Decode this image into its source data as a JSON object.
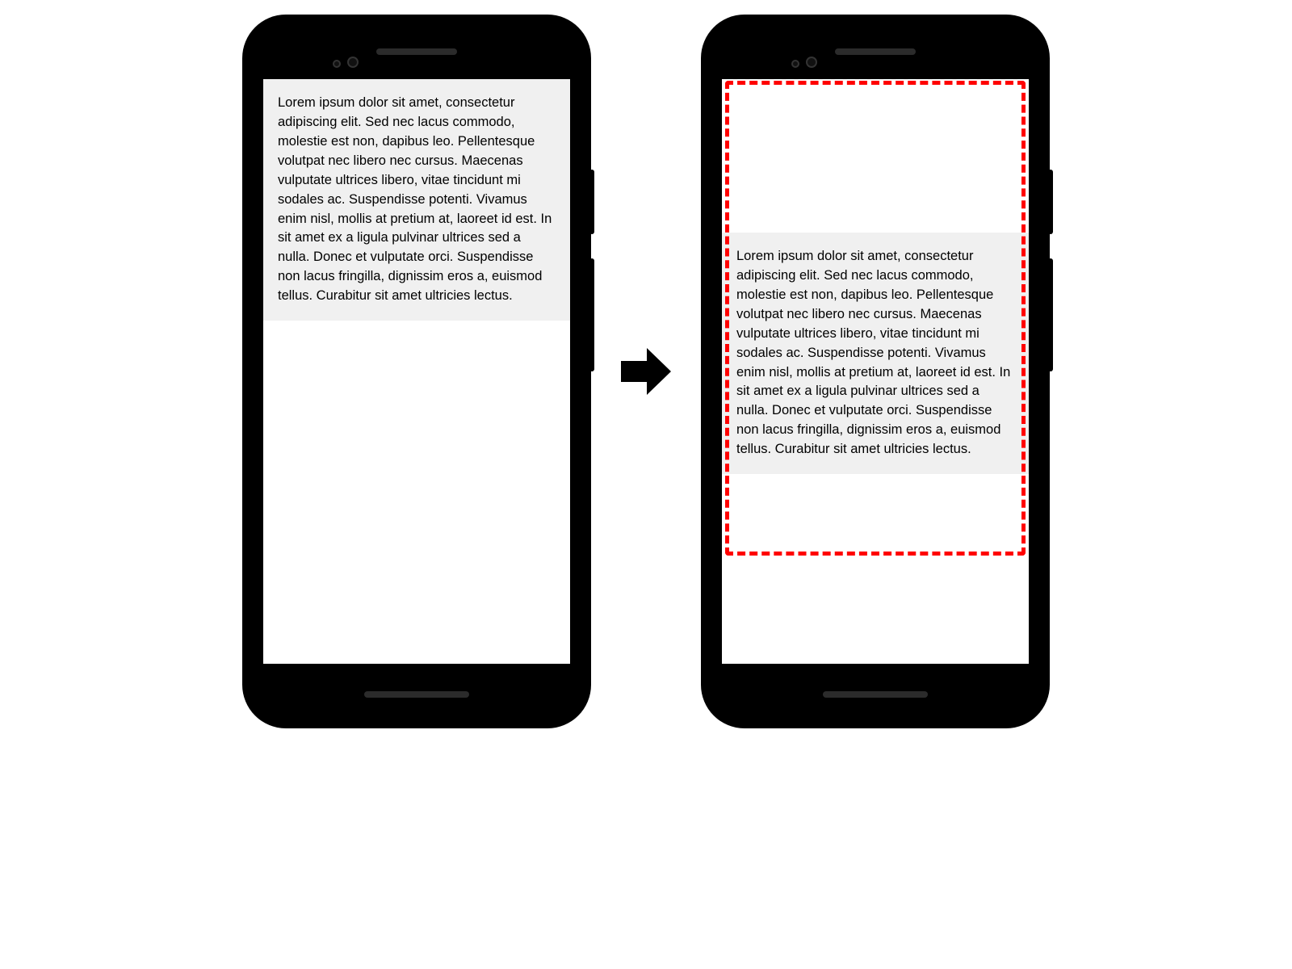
{
  "lorem_text": "Lorem ipsum dolor sit amet, consectetur adipiscing elit. Sed nec lacus commodo, molestie est non, dapibus leo. Pellentesque volutpat nec libero nec cursus. Maecenas vulputate ultrices libero, vitae tincidunt mi sodales ac. Suspendisse potenti. Vivamus enim nisl, mollis at pretium at, laoreet id est. In sit amet ex a ligula pulvinar ultrices sed a nulla. Donec et vulputate orci. Suspendisse non lacus fringilla, dignissim eros a, euismod tellus. Curabitur sit amet ultricies lectus.",
  "colors": {
    "highlight_border": "#ff0000",
    "textbox_bg": "#f0f0f0"
  }
}
